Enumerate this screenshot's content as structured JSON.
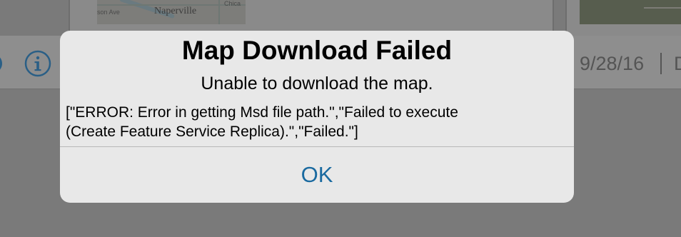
{
  "background": {
    "map_thumbnail": {
      "city_label": "Naperville",
      "street_label_left": "son Ave",
      "street_label_right": "Chica"
    },
    "info_icon": "info-circle-icon",
    "date": "9/28/16",
    "trailing_text": "D"
  },
  "alert": {
    "title": "Map Download Failed",
    "message": "Unable to download the map.",
    "detail_line1": "[\"ERROR: Error in getting Msd file path.\",\"Failed to execute",
    "detail_line2": "(Create Feature Service Replica).\",\"Failed.\"]",
    "ok_label": "OK"
  },
  "colors": {
    "accent": "#1a6aa0",
    "alert_background": "#e8e8e8",
    "dim_overlay": "#7a7a7a"
  }
}
